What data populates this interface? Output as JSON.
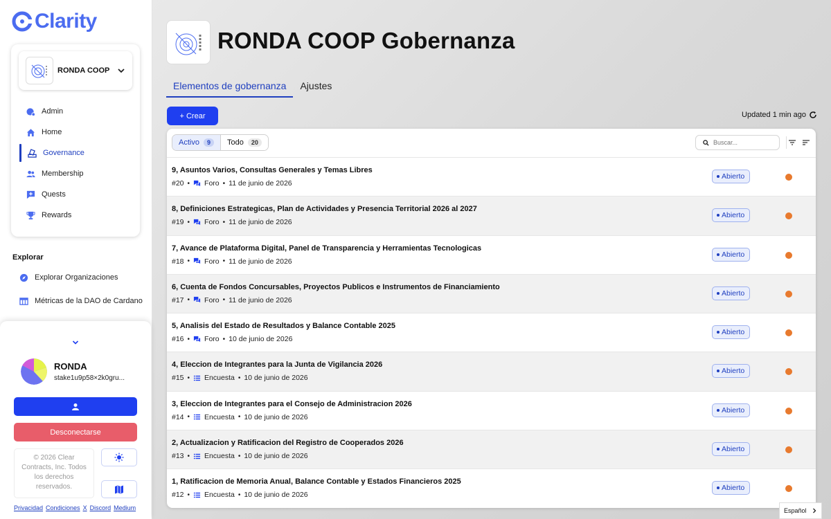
{
  "app": {
    "name": "Clarity",
    "accent": "#1f3ff0",
    "brand": "#4b6cf0"
  },
  "org_selector": {
    "name": "RONDA COOP"
  },
  "nav": [
    {
      "label": "Admin",
      "icon": "admin-icon"
    },
    {
      "label": "Home",
      "icon": "home-icon"
    },
    {
      "label": "Governance",
      "icon": "governance-icon",
      "active": true
    },
    {
      "label": "Membership",
      "icon": "membership-icon"
    },
    {
      "label": "Quests",
      "icon": "quests-icon"
    },
    {
      "label": "Rewards",
      "icon": "trophy-icon"
    }
  ],
  "explore": {
    "title": "Explorar",
    "items": [
      {
        "label": "Explorar Organizaciones",
        "icon": "compass-icon"
      },
      {
        "label": "Métricas de la DAO de Cardano",
        "icon": "table-icon"
      }
    ]
  },
  "user": {
    "name": "RONDA",
    "stake": "stake1u9p58×2k0gru..."
  },
  "actions": {
    "logout": "Desconectarse"
  },
  "footer": {
    "copyright": "© 2026 Clear Contracts, Inc. Todos los derechos reservados.",
    "links": [
      "Privacidad",
      "Condiciones",
      "X",
      "Discord",
      "Medium"
    ]
  },
  "header": {
    "title": "RONDA COOP Gobernanza",
    "tabs": [
      "Elementos de gobernanza",
      "Ajustes"
    ],
    "create_label": "+ Crear",
    "updated": "Updated 1 min ago"
  },
  "filters": [
    {
      "label": "Activo",
      "count": "9",
      "active": true
    },
    {
      "label": "Todo",
      "count": "20"
    }
  ],
  "search": {
    "placeholder": "Buscar..."
  },
  "proposals": [
    {
      "title": "9, Asuntos Varios, Consultas Generales y Temas Libres",
      "id": "#20",
      "type": "Foro",
      "date": "11 de junio de 2026",
      "status": "Abierto"
    },
    {
      "title": "8, Definiciones Estrategicas, Plan de Actividades y Presencia Territorial 2026 al 2027",
      "id": "#19",
      "type": "Foro",
      "date": "11 de junio de 2026",
      "status": "Abierto"
    },
    {
      "title": "7, Avance de Plataforma Digital, Panel de Transparencia y Herramientas Tecnologicas",
      "id": "#18",
      "type": "Foro",
      "date": "11 de junio de 2026",
      "status": "Abierto"
    },
    {
      "title": "6, Cuenta de Fondos Concursables, Proyectos Publicos e Instrumentos de Financiamiento",
      "id": "#17",
      "type": "Foro",
      "date": "11 de junio de 2026",
      "status": "Abierto"
    },
    {
      "title": "5, Analisis del Estado de Resultados y Balance Contable 2025",
      "id": "#16",
      "type": "Foro",
      "date": "10 de junio de 2026",
      "status": "Abierto"
    },
    {
      "title": "4, Eleccion de Integrantes para la Junta de Vigilancia 2026",
      "id": "#15",
      "type": "Encuesta",
      "date": "10 de junio de 2026",
      "status": "Abierto"
    },
    {
      "title": "3, Eleccion de Integrantes para el Consejo de Administracion 2026",
      "id": "#14",
      "type": "Encuesta",
      "date": "10 de junio de 2026",
      "status": "Abierto"
    },
    {
      "title": "2, Actualizacion y Ratificacion del Registro de Cooperados 2026",
      "id": "#13",
      "type": "Encuesta",
      "date": "10 de junio de 2026",
      "status": "Abierto"
    },
    {
      "title": "1, Ratificacion de Memoria Anual, Balance Contable y Estados Financieros 2025",
      "id": "#12",
      "type": "Encuesta",
      "date": "10 de junio de 2026",
      "status": "Abierto"
    }
  ],
  "language": "Español"
}
